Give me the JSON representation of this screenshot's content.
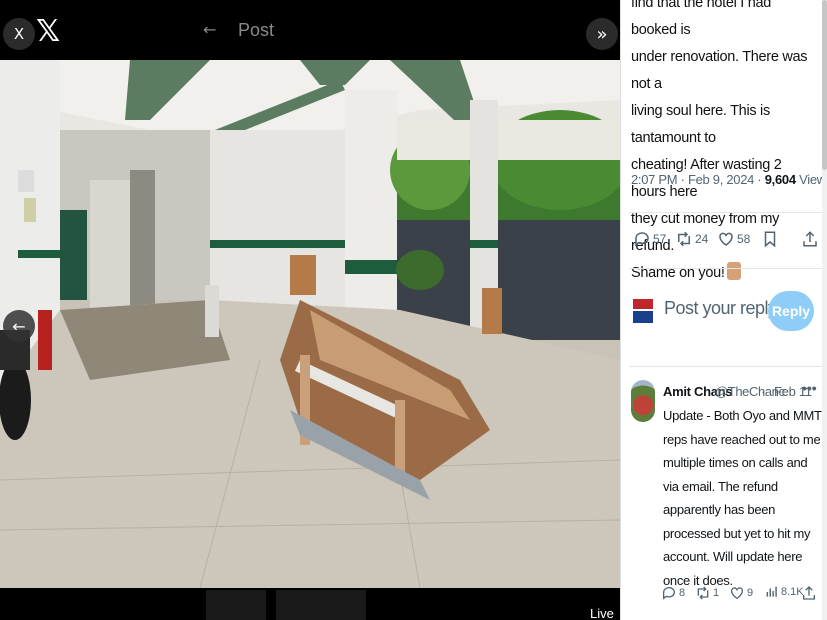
{
  "viewer": {
    "close_label": "X",
    "post_title": "Post",
    "live_label": "Live"
  },
  "tweet": {
    "text_lines": [
      "find that the hotel I had booked is",
      "under renovation. There was not a",
      "living soul here. This is tantamount to",
      "cheating! After wasting 2 hours here",
      "they cut money from my refund.",
      "Shame on you!"
    ],
    "emoji": "thumbs-down-emoji",
    "time": "2:07 PM",
    "separator": "·",
    "date": "Feb 9, 2024",
    "views_count": "9,604",
    "views_label": "Views",
    "replies": "57",
    "reposts": "24",
    "likes": "58"
  },
  "reply_box": {
    "placeholder": "Post your reply",
    "button": "Reply"
  },
  "reply": {
    "name": "Amit Chans",
    "handle": "@TheChanc",
    "dot": "·",
    "date": "Feb 11",
    "more": "•••",
    "text": "Update - Both Oyo and MMT reps have reached out to me multiple times on calls and via email. The refund apparently has been processed but yet to hit my account. Will update here once it does.",
    "replies": "8",
    "reposts": "1",
    "likes": "9",
    "views": "8.1K"
  },
  "icons": [
    "close-icon",
    "x-logo-icon",
    "back-arrow-icon",
    "next-chevrons-icon",
    "prev-arrow-icon",
    "reply-icon",
    "repost-icon",
    "like-icon",
    "bookmark-icon",
    "share-icon",
    "views-icon"
  ]
}
